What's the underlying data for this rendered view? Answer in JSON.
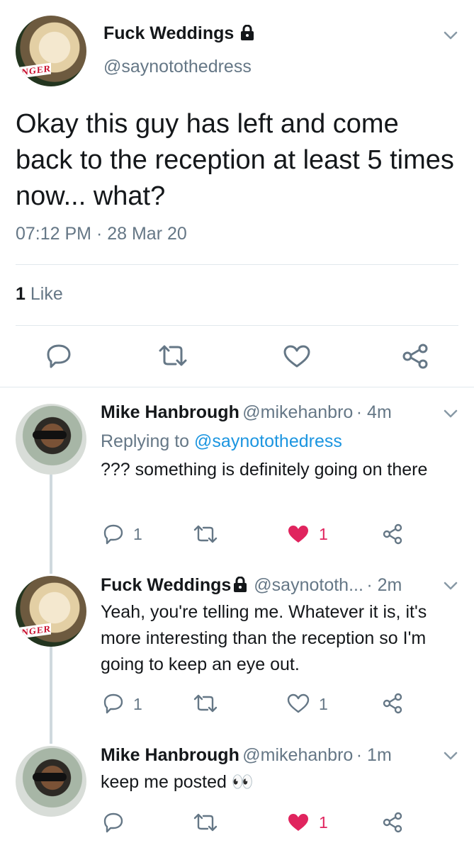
{
  "main_tweet": {
    "display_name": "Fuck Weddings",
    "handle": "@saynotothedress",
    "text": "Okay this guy has left and come back to the reception at least 5 times now... what?",
    "timestamp": "07:12 PM · 28 Mar 20",
    "like_count": "1",
    "like_label": "Like",
    "avatar_text": "NGER"
  },
  "replies": [
    {
      "display_name": "Mike Hanbrough",
      "handle": "@mikehanbro",
      "time": "· 4m",
      "replying_label": "Replying to",
      "replying_handle": "@saynotothedress",
      "text": "??? something is definitely going on there",
      "reply_count": "1",
      "like_count": "1",
      "liked": true
    },
    {
      "display_name": "Fuck Weddings",
      "handle": "@saynototh...",
      "time": "· 2m",
      "text": "Yeah, you're telling me. Whatever it is, it's more interesting than the reception so I'm going to keep an eye out.",
      "reply_count": "1",
      "like_count": "1",
      "liked": false,
      "avatar_text": "NGER"
    },
    {
      "display_name": "Mike Hanbrough",
      "handle": "@mikehanbro",
      "time": "· 1m",
      "text": "keep me posted 👀",
      "like_count": "1",
      "liked": true
    }
  ],
  "icons": [
    "chevron-down-icon",
    "lock-icon",
    "reply-icon",
    "retweet-icon",
    "heart-icon",
    "share-icon",
    "eyes-emoji"
  ],
  "colors": {
    "link": "#1b95e0",
    "like_red": "#e0245e",
    "muted": "#657786",
    "divider": "#e1e8ed"
  }
}
